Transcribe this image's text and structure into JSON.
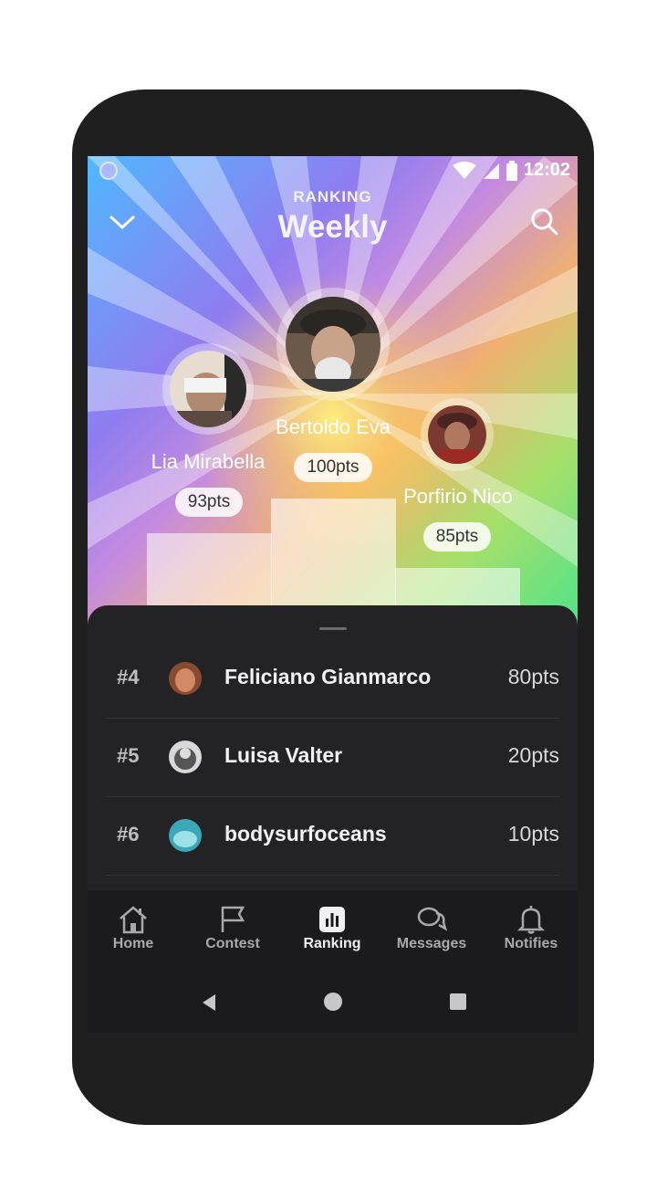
{
  "status": {
    "time": "12:02"
  },
  "header": {
    "subtitle": "RANKING",
    "title": "Weekly"
  },
  "podium": [
    {
      "rank": 1,
      "name": "Bertoldo Eva",
      "points": "100pts"
    },
    {
      "rank": 2,
      "name": "Lia Mirabella",
      "points": "93pts"
    },
    {
      "rank": 3,
      "name": "Porfirio Nico",
      "points": "85pts"
    }
  ],
  "list": [
    {
      "rank": "#4",
      "name": "Feliciano Gianmarco",
      "points": "80pts"
    },
    {
      "rank": "#5",
      "name": "Luisa Valter",
      "points": "20pts"
    },
    {
      "rank": "#6",
      "name": "bodysurfoceans",
      "points": "10pts"
    }
  ],
  "nav": [
    {
      "label": "Home",
      "icon": "home-icon"
    },
    {
      "label": "Contest",
      "icon": "flag-icon"
    },
    {
      "label": "Ranking",
      "icon": "bar-chart-icon",
      "active": true
    },
    {
      "label": "Messages",
      "icon": "chat-bubbles-icon"
    },
    {
      "label": "Notifies",
      "icon": "bell-icon"
    }
  ],
  "colors": {
    "sheet": "#232326",
    "accent_gradient_start": "#4fb8ff",
    "accent_gradient_end": "#4fe38a"
  }
}
